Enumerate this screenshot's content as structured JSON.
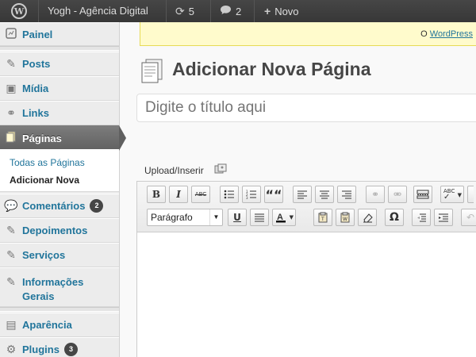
{
  "adminbar": {
    "site_name": "Yogh - Agência Digital",
    "updates_count": "5",
    "comments_count": "2",
    "new_label": "Novo"
  },
  "sidebar": {
    "items": [
      {
        "label": "Painel",
        "icon": "dashboard-icon"
      },
      {
        "label": "Posts",
        "icon": "pin-icon"
      },
      {
        "label": "Mídia",
        "icon": "media-icon"
      },
      {
        "label": "Links",
        "icon": "link-icon"
      },
      {
        "label": "Páginas",
        "icon": "pages-icon",
        "active": true
      },
      {
        "label": "Comentários",
        "icon": "comment-icon",
        "badge": "2"
      },
      {
        "label": "Depoimentos",
        "icon": "pin-icon"
      },
      {
        "label": "Serviços",
        "icon": "pin-icon"
      },
      {
        "label": "Informações",
        "label2": "Gerais",
        "icon": "pin-icon"
      },
      {
        "label": "Aparência",
        "icon": "appearance-icon"
      },
      {
        "label": "Plugins",
        "icon": "plugin-icon",
        "badge": "3"
      }
    ],
    "submenu": [
      {
        "label": "Todas as Páginas"
      },
      {
        "label": "Adicionar Nova",
        "current": true
      }
    ]
  },
  "notice": {
    "prefix": "O",
    "link": "WordPress"
  },
  "main": {
    "title": "Adicionar Nova Página",
    "title_placeholder": "Digite o título aqui",
    "upload_label": "Upload/Inserir"
  },
  "editor": {
    "format_value": "Parágrafo",
    "bold": "B",
    "italic": "I",
    "strike": "ABC",
    "underline": "U",
    "quote": "““",
    "omega": "Ω",
    "spell": "ABC"
  }
}
